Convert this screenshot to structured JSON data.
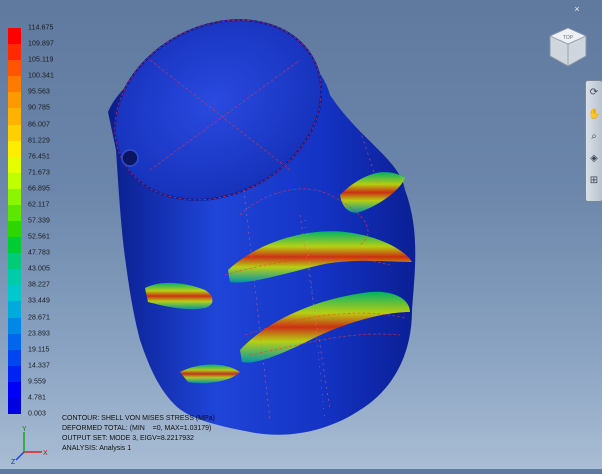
{
  "legend": {
    "values": [
      "114.675",
      "109.897",
      "105.119",
      "100.341",
      "95.563",
      "90.785",
      "86.007",
      "81.229",
      "76.451",
      "71.673",
      "66.895",
      "62.117",
      "57.339",
      "52.561",
      "47.783",
      "43.005",
      "38.227",
      "33.449",
      "28.671",
      "23.893",
      "19.115",
      "14.337",
      "9.559",
      "4.781",
      "0.003"
    ],
    "colors": [
      "#ff0000",
      "#ff2a00",
      "#ff5500",
      "#ff7a00",
      "#ff9900",
      "#ffb300",
      "#ffd000",
      "#ffee00",
      "#e6ff00",
      "#c0ff00",
      "#8cf500",
      "#5ce600",
      "#2ed600",
      "#00cc33",
      "#00cc77",
      "#00ccaa",
      "#00c8cc",
      "#00aadd",
      "#0088e6",
      "#0066ee",
      "#0044f2",
      "#0022f5",
      "#0000f8",
      "#0000e0"
    ]
  },
  "info": {
    "line1": "CONTOUR: SHELL VON MISES STRESS (MPa)",
    "line2": "DEFORMED TOTAL: (MIN    =0, MAX=1.03179)",
    "line3": "OUTPUT SET: MODE 3, EIGV=8.2217932",
    "line4": "ANALYSIS: Analysis 1"
  },
  "viewcube": {
    "face_label": "TOP"
  },
  "triad": {
    "x_label": "X",
    "y_label": "Y",
    "z_label": "Z"
  },
  "toolbar": {
    "buttons": [
      {
        "name": "orbit-icon",
        "glyph": "⟳"
      },
      {
        "name": "pan-icon",
        "glyph": "✋"
      },
      {
        "name": "zoom-icon",
        "glyph": "⌕"
      },
      {
        "name": "lookat-icon",
        "glyph": "◈"
      },
      {
        "name": "zoom-window-icon",
        "glyph": "⊞"
      }
    ]
  },
  "close": {
    "glyph": "×"
  }
}
